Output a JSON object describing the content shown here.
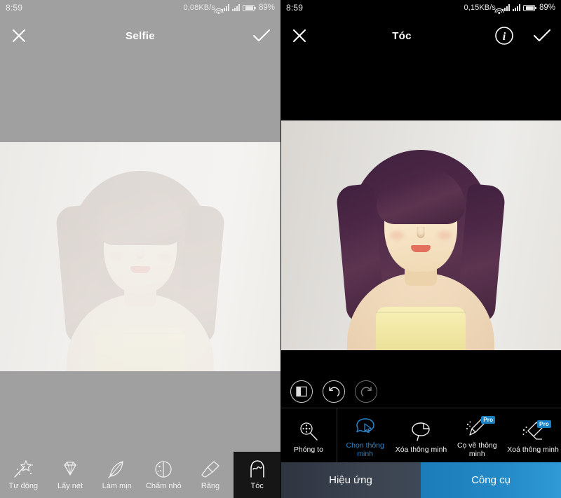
{
  "left": {
    "status": {
      "time": "8:59",
      "network_speed": "0,08KB/s",
      "battery_percent": "89%",
      "wifi_icon": "wifi-icon",
      "signal_icon": "signal-bars-icon",
      "battery_icon": "battery-icon"
    },
    "header": {
      "close_icon": "close-icon",
      "title": "Selfie",
      "confirm_icon": "check-icon"
    },
    "toolbar": {
      "items": [
        {
          "label": "Tự động",
          "icon": "magic-wand-icon",
          "selected": false
        },
        {
          "label": "Lấy nét",
          "icon": "diamond-icon",
          "selected": false
        },
        {
          "label": "Làm mịn",
          "icon": "feather-icon",
          "selected": false
        },
        {
          "label": "Chấm nhỏ",
          "icon": "blemish-dots-icon",
          "selected": false
        },
        {
          "label": "Răng",
          "icon": "toothbrush-icon",
          "selected": false
        },
        {
          "label": "Tóc",
          "icon": "hair-icon",
          "selected": true
        }
      ]
    }
  },
  "right": {
    "status": {
      "time": "8:59",
      "network_speed": "0,15KB/s",
      "battery_percent": "89%",
      "wifi_icon": "wifi-icon",
      "signal_icon": "signal-bars-icon",
      "battery_icon": "battery-icon"
    },
    "header": {
      "close_icon": "close-icon",
      "title": "Tóc",
      "info_icon": "info-circle-icon",
      "confirm_icon": "check-icon"
    },
    "actions": [
      {
        "name": "compare-button",
        "icon": "compare-split-icon",
        "enabled": true
      },
      {
        "name": "undo-button",
        "icon": "undo-icon",
        "enabled": true
      },
      {
        "name": "redo-button",
        "icon": "redo-icon",
        "enabled": false
      }
    ],
    "tools": [
      {
        "label": "Phóng to",
        "icon": "magnifier-move-icon",
        "active": false,
        "pro": false
      },
      {
        "label": "Chọn thông minh",
        "icon": "smart-select-icon",
        "active": true,
        "pro": false
      },
      {
        "label": "Xóa thông minh",
        "icon": "smart-erase-icon",
        "active": false,
        "pro": false
      },
      {
        "label": "Cọ vẽ thông minh",
        "icon": "smart-brush-icon",
        "active": false,
        "pro": true
      },
      {
        "label": "Xoá thông minh",
        "icon": "smart-eraser-icon",
        "active": false,
        "pro": true
      }
    ],
    "pro_badge_label": "Pro",
    "tabs": [
      {
        "label": "Hiệu ứng",
        "active": false
      },
      {
        "label": "Công cụ",
        "active": true
      }
    ]
  },
  "colors": {
    "left_chrome": "#a0a0a0",
    "right_chrome": "#000000",
    "accent_blue": "#2a84c8",
    "tab_active_blue": "#2389c6",
    "tab_inactive": "#3b4350",
    "pro_badge": "#1a7fc1"
  }
}
